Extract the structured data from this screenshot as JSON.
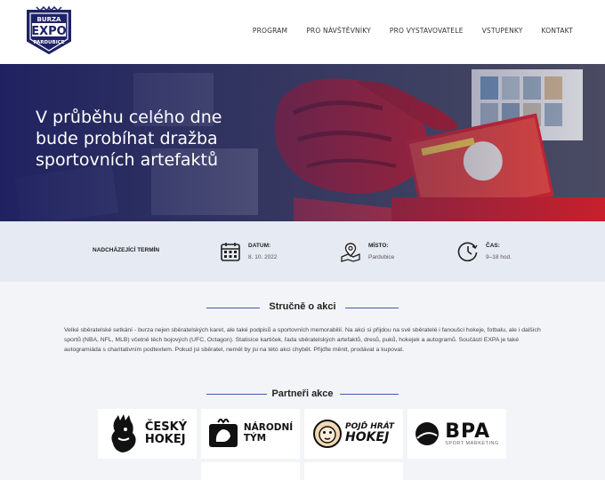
{
  "brand": {
    "logo_top": "BURZA",
    "logo_main": "EXPO",
    "logo_bottom": "PARDUBICE"
  },
  "nav": {
    "items": [
      {
        "label": "PROGRAM"
      },
      {
        "label": "PRO NÁVŠTĚVNÍKY"
      },
      {
        "label": "PRO VYSTAVOVATELE"
      },
      {
        "label": "VSTUPENKY"
      },
      {
        "label": "KONTAKT"
      }
    ]
  },
  "hero": {
    "title": "V průběhu celého dne bude probíhat dražba sportovních artefaktů"
  },
  "upcoming": {
    "label": "NADCHÁZEJÍCÍ TERMÍN",
    "date_key": "DATUM:",
    "date_value": "8. 10. 2022",
    "place_key": "MÍSTO:",
    "place_value": "Pardubice",
    "time_key": "ČAS:",
    "time_value": "9–18 hod."
  },
  "about": {
    "title": "Stručně o akci",
    "text": "Velké sběratelské setkání - burza nejen sběratelských karet, ale také podpisů a sportovních memorabilií. Na akci si přijdou na své sběratelé i fanoušci hokeje, fotbalu, ale i dalších sportů (NBA, NFL, MLB) včetně těch bojových (UFC, Octagon). Statisíce kartiček, řada sběratelských artefaktů, dresů, puků, hokejek a autogramů. Součástí EXPA je také autogramiáda s charitativním podtextem. Pokud jsi sběratel, neměl by jsi na této akci chybět. Přijďte měnit, prodávat a kupovat."
  },
  "partners": {
    "title": "Partneři akce",
    "items": [
      {
        "line1": "ČESKÝ",
        "line2": "HOKEJ"
      },
      {
        "line1": "NÁRODNÍ",
        "line2": "TÝM"
      },
      {
        "line1": "POJĎ HRÁT",
        "line2": "HOKEJ"
      },
      {
        "line1": "BPA",
        "line2": "SPORT MARKETING"
      }
    ]
  },
  "colors": {
    "accent": "#3a5bb0",
    "hero_dark": "#1e2160",
    "info_bg": "#e6eaf2"
  }
}
